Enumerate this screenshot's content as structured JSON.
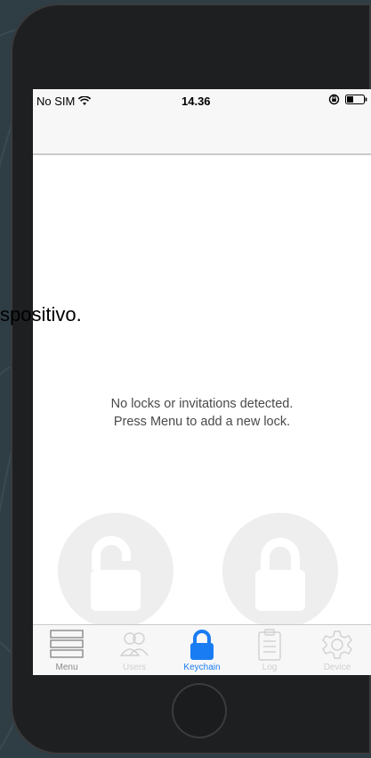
{
  "status_bar": {
    "carrier": "No SIM",
    "time": "14.36"
  },
  "content": {
    "overflow_text": "spositivo.",
    "empty_line1": "No locks or invitations detected.",
    "empty_line2": "Press Menu to add a new lock."
  },
  "tabs": [
    {
      "label": "Menu",
      "icon": "menu-icon"
    },
    {
      "label": "Users",
      "icon": "users-icon"
    },
    {
      "label": "Keychain",
      "icon": "lock-icon"
    },
    {
      "label": "Log",
      "icon": "clipboard-icon"
    },
    {
      "label": "Device",
      "icon": "gear-icon"
    }
  ],
  "colors": {
    "accent": "#1a7cf2",
    "background": "#2f3e45"
  }
}
